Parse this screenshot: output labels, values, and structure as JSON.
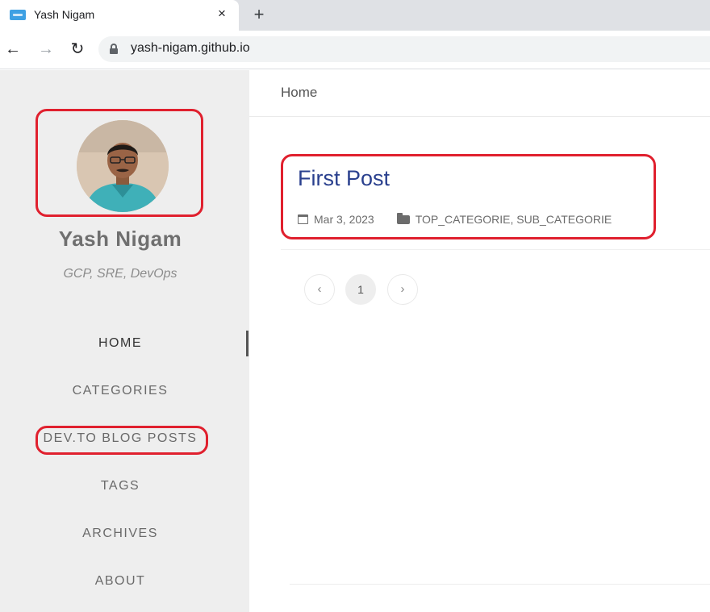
{
  "browser": {
    "tab_title": "Yash Nigam",
    "close_glyph": "×",
    "new_tab_glyph": "+",
    "back_glyph": "←",
    "forward_glyph": "→",
    "reload_glyph": "↻",
    "url": "yash-nigam.github.io"
  },
  "sidebar": {
    "name": "Yash Nigam",
    "description": "GCP, SRE, DevOps",
    "menu": [
      {
        "label": "HOME",
        "active": true
      },
      {
        "label": "CATEGORIES"
      },
      {
        "label": "DEV.TO BLOG POSTS"
      },
      {
        "label": "TAGS"
      },
      {
        "label": "ARCHIVES"
      },
      {
        "label": "ABOUT"
      }
    ]
  },
  "main": {
    "breadcrumb": "Home",
    "posts": [
      {
        "title": "First Post",
        "date": "Mar 3, 2023",
        "categories": "TOP_CATEGORIE, SUB_CATEGORIE"
      }
    ],
    "pagination": {
      "prev_glyph": "‹",
      "current": "1",
      "next_glyph": "›"
    }
  },
  "colors": {
    "highlight": "#e0202e",
    "post_title": "#2a408e",
    "sidebar_bg": "#eeeeee"
  }
}
